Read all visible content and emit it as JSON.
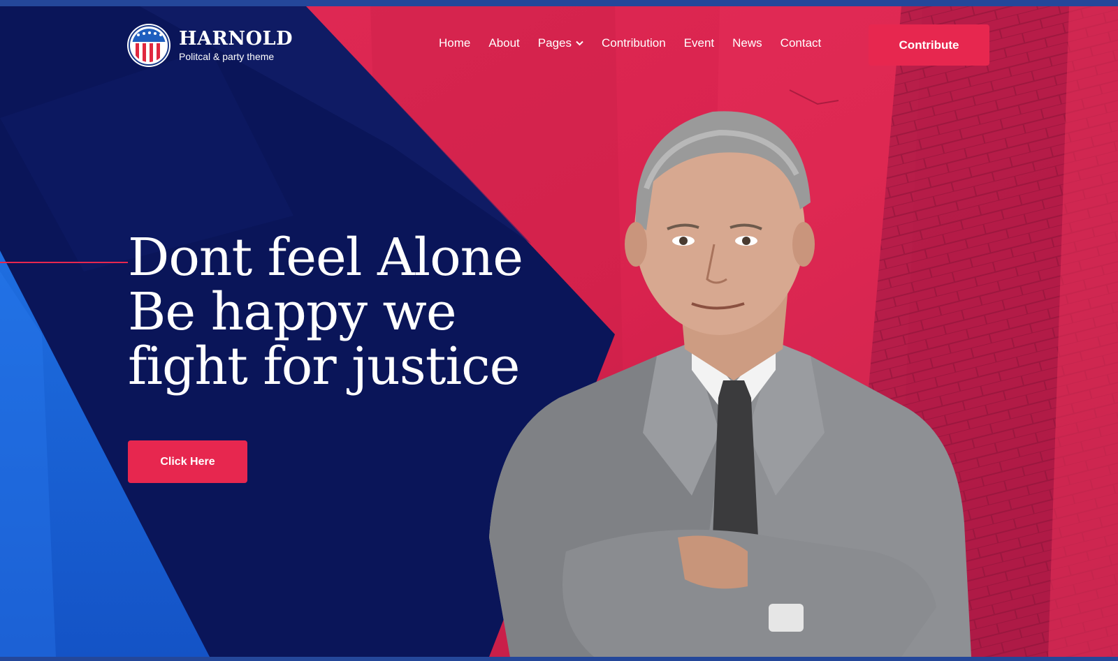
{
  "brand": {
    "name": "HARNOLD",
    "tagline": "Politcal & party theme"
  },
  "nav": {
    "items": [
      "Home",
      "About",
      "Pages",
      "Contribution",
      "Event",
      "News",
      "Contact"
    ],
    "pages_has_dropdown": true
  },
  "header": {
    "contribute_label": "Contribute"
  },
  "hero": {
    "title_lines": [
      "Dont feel Alone",
      "Be happy we",
      "fight for justice"
    ],
    "cta_label": "Click Here"
  },
  "icons": {
    "logo": "flag-shield-icon",
    "dropdown": "chevron-down-icon"
  },
  "colors": {
    "navy": "#0a1559",
    "accent_red": "#e7274f",
    "blue": "#1b63d8",
    "strip": "#24479a"
  }
}
